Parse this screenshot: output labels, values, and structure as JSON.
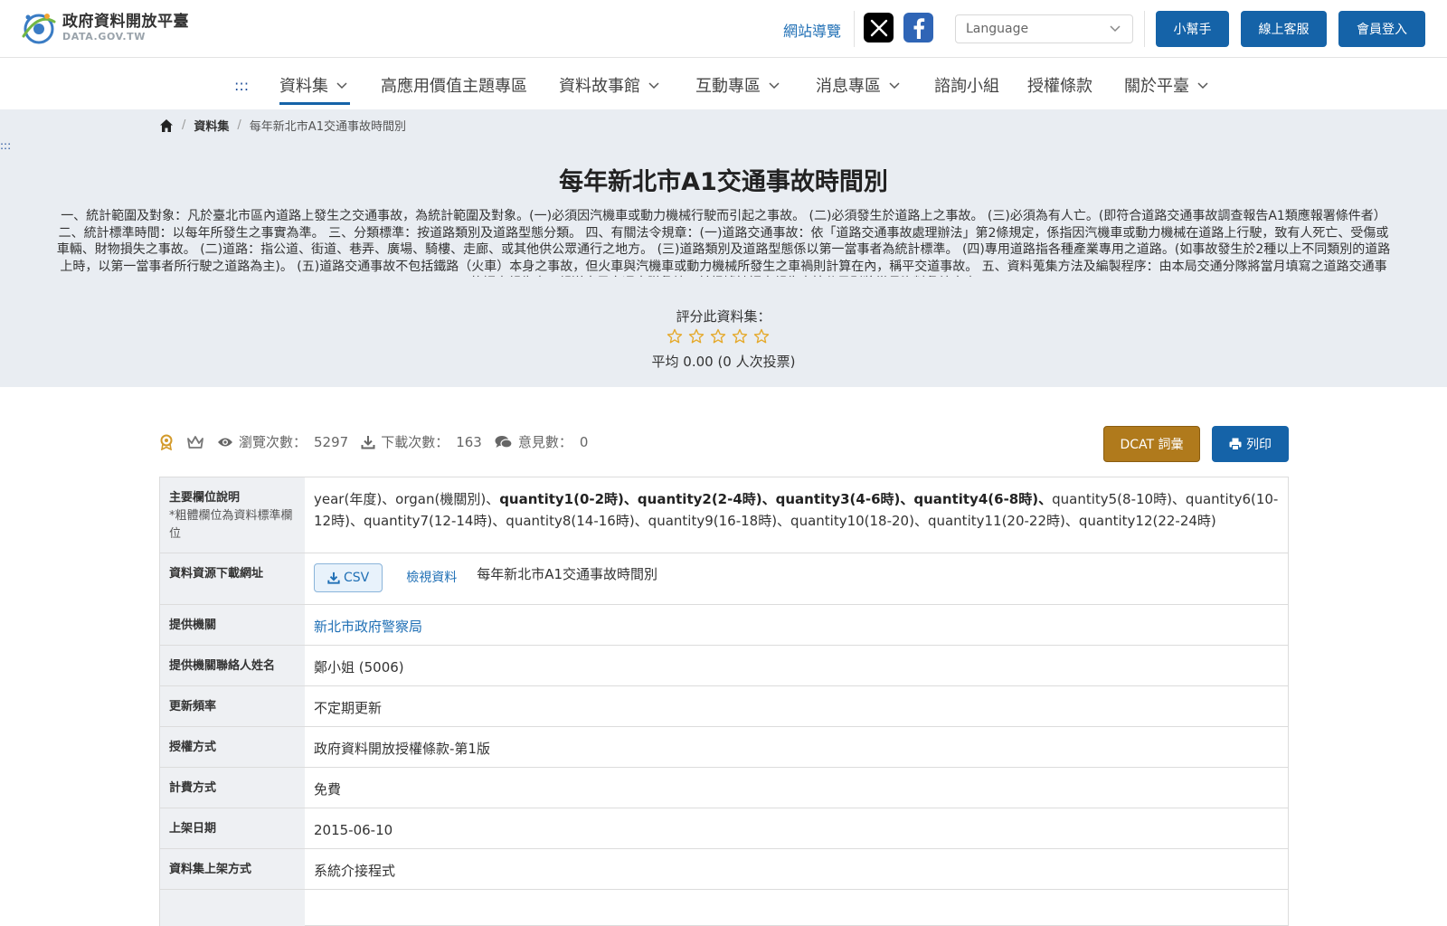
{
  "header": {
    "logo_title": "政府資料開放平臺",
    "logo_sub": "DATA.GOV.TW",
    "sitemap": "網站導覽",
    "language_placeholder": "Language",
    "helper_btn": "小幫手",
    "service_btn": "線上客服",
    "login_btn": "會員登入"
  },
  "nav": {
    "dots": ":::",
    "items": [
      "資料集",
      "高應用價值主題專區",
      "資料故事館",
      "互動專區",
      "消息專區",
      "諮詢小組",
      "授權條款",
      "關於平臺"
    ]
  },
  "breadcrumb": {
    "level1": "資料集",
    "current": "每年新北市A1交通事故時間別"
  },
  "side_dots": ":::",
  "dataset": {
    "title": "每年新北市A1交通事故時間別",
    "description": "一、統計範圍及對象：凡於臺北市區內道路上發生之交通事故，為統計範圍及對象。(一)必須因汽機車或動力機械行駛而引起之事故。 (二)必須發生於道路上之事故。 (三)必須為有人亡。(即符合道路交通事故調查報告A1類應報署條件者） 二、統計標準時間：以每年所發生之事實為準。 三、分類標準：按道路類別及道路型態分類。 四、有關法令規章：(一)道路交通事故：依「道路交通事故處理辦法」第2條規定，係指因汽機車或動力機械在道路上行駛，致有人死亡、受傷或車輛、財物損失之事故。 (二)道路：指公道、街道、巷弄、廣場、騎樓、走廊、或其他供公眾通行之地方。 (三)道路類別及道路型態係以第一當事者為統計標準。 (四)專用道路指各種產業專用之道路。(如事故發生於2種以上不同類別的道路上時，以第一當事者所行駛之道路為主)。 (五)道路交通事故不包括鐵路（火車）本身之事故，但火車與汽機車或動力機械所發生之車禍則計算在內，稱平交道事故。 五、資料蒐集方法及編製程序：由本局交通分隊將當月填寫之道路交通事故調查報告表，報送本局交通大隊彙編。並根據該調查報告表按分局別將當月資料彙編本表",
    "rate_label": "評分此資料集：",
    "rating_value": 0,
    "rating_max": 5,
    "rate_avg": "平均 0.00 (0 人次投票)"
  },
  "stats": {
    "views_label": "瀏覽次數：",
    "views": "5297",
    "downloads_label": "下載次數：",
    "downloads": "163",
    "comments_label": "意見數：",
    "comments": "0",
    "dcat_btn": "DCAT 詞彙",
    "print_btn": "列印"
  },
  "table": {
    "fields": {
      "label": "主要欄位說明",
      "note": "*粗體欄位為資料標準欄位",
      "normal_prefix": "year(年度)、organ(機關別)、",
      "bold": "quantity1(0-2時)、quantity2(2-4時)、quantity3(4-6時)、quantity4(6-8時)、",
      "normal_suffix": "quantity5(8-10時)、quantity6(10-12時)、quantity7(12-14時)、quantity8(14-16時)、quantity9(16-18時)、quantity10(18-20)、quantity11(20-22時)、quantity12(22-24時)"
    },
    "resource": {
      "label": "資料資源下載網址",
      "csv": "CSV",
      "view": "檢視資料",
      "name": "每年新北市A1交通事故時間別"
    },
    "provider": {
      "label": "提供機關",
      "value": "新北市政府警察局"
    },
    "contact": {
      "label": "提供機關聯絡人姓名",
      "value": "鄭小姐 (5006)"
    },
    "frequency": {
      "label": "更新頻率",
      "value": "不定期更新"
    },
    "license": {
      "label": "授權方式",
      "value": "政府資料開放授權條款-第1版"
    },
    "fee": {
      "label": "計費方式",
      "value": "免費"
    },
    "published": {
      "label": "上架日期",
      "value": "2015-06-10"
    },
    "method": {
      "label": "資料集上架方式",
      "value": "系統介接程式"
    }
  },
  "colors": {
    "primary": "#1563a8",
    "dcat": "#b07a1c",
    "banner_bg": "#e9edf2",
    "star": "#e5a92b"
  }
}
